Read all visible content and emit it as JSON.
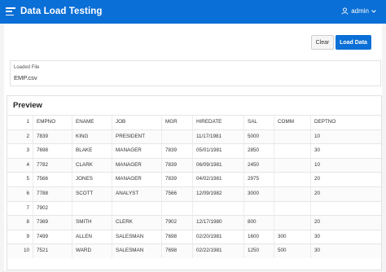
{
  "header": {
    "title": "Data Load Testing",
    "user": "admin"
  },
  "buttons": {
    "clear": "Clear",
    "load": "Load Data"
  },
  "loaded_file": {
    "label": "Loaded File",
    "value": "EMP.csv"
  },
  "preview": {
    "title": "Preview",
    "rows": [
      [
        "1",
        "EMPNO",
        "ENAME",
        "JOB",
        "MGR",
        "HIREDATE",
        "SAL",
        "COMM",
        "DEPTNO"
      ],
      [
        "2",
        "7839",
        "KING",
        "PRESIDENT",
        "",
        "11/17/1981",
        "5000",
        "",
        "10"
      ],
      [
        "3",
        "7698",
        "BLAKE",
        "MANAGER",
        "7839",
        "05/01/1981",
        "2850",
        "",
        "30"
      ],
      [
        "4",
        "7782",
        "CLARK",
        "MANAGER",
        "7839",
        "06/09/1981",
        "2450",
        "",
        "10"
      ],
      [
        "5",
        "7566",
        "JONES",
        "MANAGER",
        "7839",
        "04/02/1981",
        "2975",
        "",
        "20"
      ],
      [
        "6",
        "7788",
        "SCOTT",
        "ANALYST",
        "7566",
        "12/09/1982",
        "3000",
        "",
        "20"
      ],
      [
        "7",
        "7902",
        "",
        "",
        "",
        "",
        "",
        "",
        ""
      ],
      [
        "8",
        "7369",
        "SMITH",
        "CLERK",
        "7902",
        "12/17/1980",
        "800",
        "",
        "20"
      ],
      [
        "9",
        "7499",
        "ALLEN",
        "SALESMAN",
        "7698",
        "02/20/1981",
        "1600",
        "300",
        "30"
      ],
      [
        "10",
        "7521",
        "WARD",
        "SALESMAN",
        "7698",
        "02/22/1981",
        "1250",
        "500",
        "30"
      ]
    ]
  },
  "colors": {
    "accent": "#0a6fd6"
  }
}
